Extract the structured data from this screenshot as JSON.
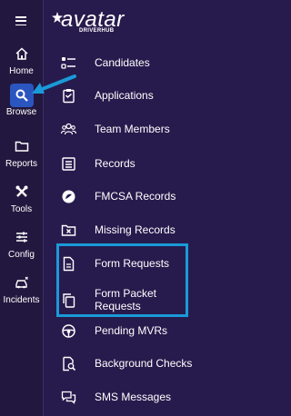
{
  "brand": {
    "name": "avatar",
    "subtitle": "DRIVERHUB"
  },
  "rail": {
    "items": [
      {
        "label": "Home",
        "icon": "home-icon"
      },
      {
        "label": "Browse",
        "icon": "search-icon",
        "active": true
      },
      {
        "label": "Reports",
        "icon": "folder-icon"
      },
      {
        "label": "Tools",
        "icon": "tools-icon"
      },
      {
        "label": "Config",
        "icon": "sliders-icon"
      },
      {
        "label": "Incidents",
        "icon": "car-crash-icon"
      }
    ]
  },
  "menu": {
    "items": [
      {
        "label": "Candidates",
        "icon": "list-icon"
      },
      {
        "label": "Applications",
        "icon": "clipboard-icon"
      },
      {
        "label": "Team Members",
        "icon": "team-icon"
      },
      {
        "label": "Records",
        "icon": "records-icon"
      },
      {
        "label": "FMCSA Records",
        "icon": "fmcsa-icon"
      },
      {
        "label": "Missing Records",
        "icon": "folder-x-icon"
      },
      {
        "label": "Form Requests",
        "icon": "document-icon"
      },
      {
        "label": "Form Packet Requests",
        "icon": "copy-icon"
      },
      {
        "label": "Pending MVRs",
        "icon": "steering-wheel-icon"
      },
      {
        "label": "Background Checks",
        "icon": "search-document-icon"
      },
      {
        "label": "SMS Messages",
        "icon": "chat-icon"
      }
    ]
  },
  "annotation": {
    "highlight_color": "#1a9ad8",
    "arrow_color": "#1a9ad8"
  },
  "colors": {
    "background": "#271b4d",
    "rail": "#22183f",
    "active": "#2b55bf"
  }
}
